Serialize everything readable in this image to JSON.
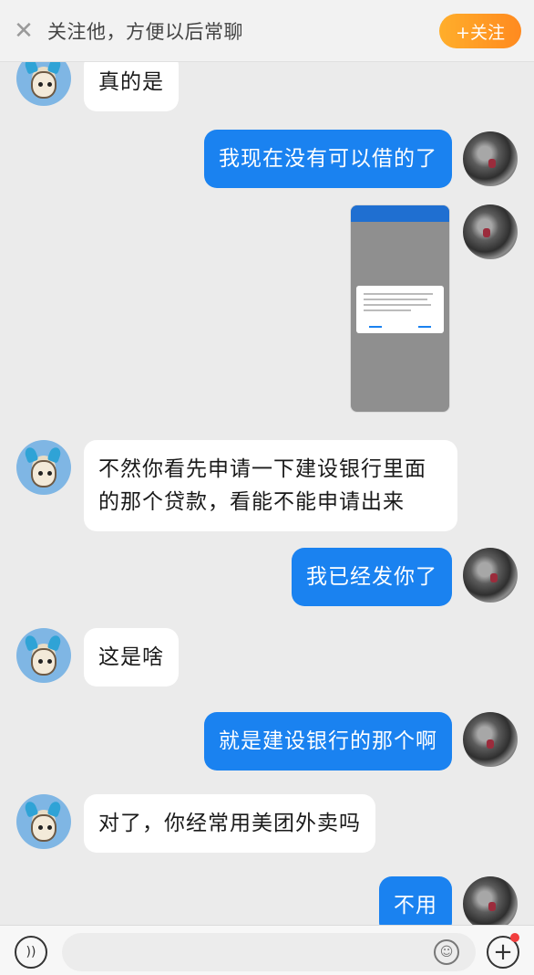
{
  "banner": {
    "close_icon": "close-icon",
    "text": "关注他，方便以后常聊",
    "follow_label": "+关注",
    "follow_color": "#ff9a24"
  },
  "messages": [
    {
      "side": "left",
      "text": "真的是"
    },
    {
      "side": "right",
      "text": "我现在没有可以借的了"
    },
    {
      "side": "right",
      "type": "image"
    },
    {
      "side": "left",
      "text": "不然你看先申请一下建设银行里面的那个贷款，看能不能申请出来"
    },
    {
      "side": "right",
      "text": "我已经发你了"
    },
    {
      "side": "left",
      "text": "这是啥"
    },
    {
      "side": "right",
      "text": "就是建设银行的那个啊"
    },
    {
      "side": "left",
      "text": "对了，你经常用美团外卖吗"
    },
    {
      "side": "right",
      "text": "不用"
    }
  ],
  "colors": {
    "outgoing_bubble": "#1a82f0",
    "incoming_bubble": "#ffffff",
    "background": "#ebebeb"
  },
  "input_bar": {
    "voice_icon": "voice-icon",
    "emoji_icon": "emoji-icon",
    "plus_icon": "plus-icon"
  }
}
